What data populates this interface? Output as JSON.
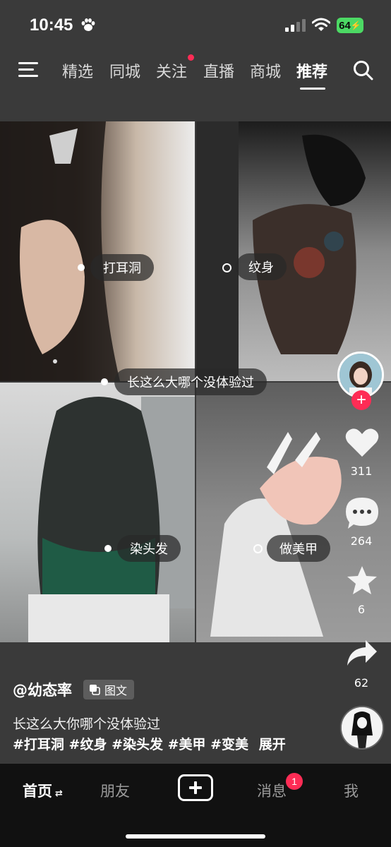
{
  "status_bar": {
    "time": "10:45",
    "battery": "64"
  },
  "nav": {
    "tabs": [
      {
        "label": "精选"
      },
      {
        "label": "同城"
      },
      {
        "label": "关注"
      },
      {
        "label": "直播"
      },
      {
        "label": "商城"
      },
      {
        "label": "推荐"
      }
    ],
    "active_tab": "推荐"
  },
  "post": {
    "tags": {
      "ear": "打耳洞",
      "tattoo": "纹身",
      "center": "长这么大哪个没体验过",
      "hair": "染头发",
      "nails": "做美甲"
    },
    "author": "@幼态率",
    "type_label": "图文",
    "caption": "长这么大你哪个没体验过",
    "hashtags": "#打耳洞 #纹身 #染头发 #美甲 #变美",
    "expand_label": "展开"
  },
  "actions": {
    "likes": "311",
    "comments": "264",
    "favorites": "6",
    "shares": "62"
  },
  "tabbar": {
    "home": "首页",
    "friends": "朋友",
    "messages": "消息",
    "messages_badge": "1",
    "me": "我"
  },
  "colors": {
    "accent_red": "#fe2c55",
    "battery_green": "#4cd964",
    "background": "#3a3a3a"
  }
}
